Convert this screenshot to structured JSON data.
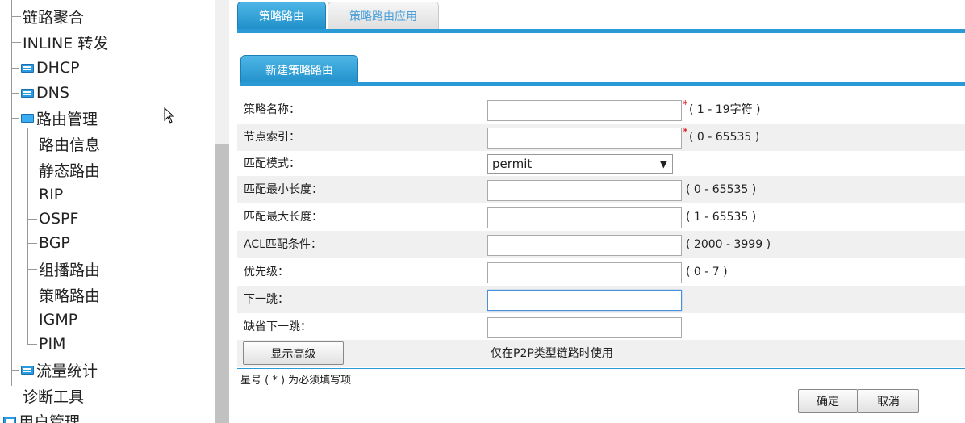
{
  "sidebar": {
    "items": [
      {
        "label": "链路聚合",
        "level": 1,
        "icon": "none"
      },
      {
        "label": "INLINE 转发",
        "level": 1,
        "icon": "none"
      },
      {
        "label": "DHCP",
        "level": 1,
        "icon": "folder-closed"
      },
      {
        "label": "DNS",
        "level": 1,
        "icon": "folder-closed"
      },
      {
        "label": "路由管理",
        "level": 1,
        "icon": "folder-open"
      },
      {
        "label": "路由信息",
        "level": 2,
        "icon": "none"
      },
      {
        "label": "静态路由",
        "level": 2,
        "icon": "none"
      },
      {
        "label": "RIP",
        "level": 2,
        "icon": "none"
      },
      {
        "label": "OSPF",
        "level": 2,
        "icon": "none"
      },
      {
        "label": "BGP",
        "level": 2,
        "icon": "none"
      },
      {
        "label": "组播路由",
        "level": 2,
        "icon": "none"
      },
      {
        "label": "策略路由",
        "level": 2,
        "icon": "none"
      },
      {
        "label": "IGMP",
        "level": 2,
        "icon": "none"
      },
      {
        "label": "PIM",
        "level": 2,
        "icon": "none"
      },
      {
        "label": "流量统计",
        "level": 1,
        "icon": "folder-closed"
      },
      {
        "label": "诊断工具",
        "level": 1,
        "icon": "none"
      },
      {
        "label": "用户管理",
        "level": 0,
        "icon": "folder-closed"
      }
    ]
  },
  "tabs": [
    {
      "label": "策略路由",
      "active": true
    },
    {
      "label": "策略路由应用",
      "active": false
    }
  ],
  "subtab": {
    "label": "新建策略路由"
  },
  "form": {
    "policy_name": {
      "label": "策略名称：",
      "value": "",
      "required": "*",
      "hint": "( 1 - 19字符 )"
    },
    "node_index": {
      "label": "节点索引：",
      "value": "",
      "required": "*",
      "hint": "( 0 - 65535 )"
    },
    "match_mode": {
      "label": "匹配模式：",
      "selected": "permit",
      "arrow": "▼"
    },
    "min_len": {
      "label": "匹配最小长度：",
      "value": "",
      "hint": "( 0 - 65535 )"
    },
    "max_len": {
      "label": "匹配最大长度：",
      "value": "",
      "hint": "( 1 - 65535 )"
    },
    "acl": {
      "label": "ACL匹配条件：",
      "value": "",
      "hint": "( 2000 - 3999 )"
    },
    "priority": {
      "label": "优先级：",
      "value": "",
      "hint": "( 0 - 7 )"
    },
    "next_hop": {
      "label": "下一跳：",
      "value": ""
    },
    "default_next_hop": {
      "label": "缺省下一跳：",
      "value": ""
    },
    "advanced_button": "显示高级",
    "p2p_note": "仅在P2P类型链路时使用"
  },
  "footer": {
    "required_note": "星号 ( * ) 为必须填写项",
    "ok_label": "确定",
    "cancel_label": "取消"
  },
  "colors": {
    "accent": "#2a9ad6",
    "required": "#dd0000",
    "row_shade": "#f0f0f0"
  }
}
